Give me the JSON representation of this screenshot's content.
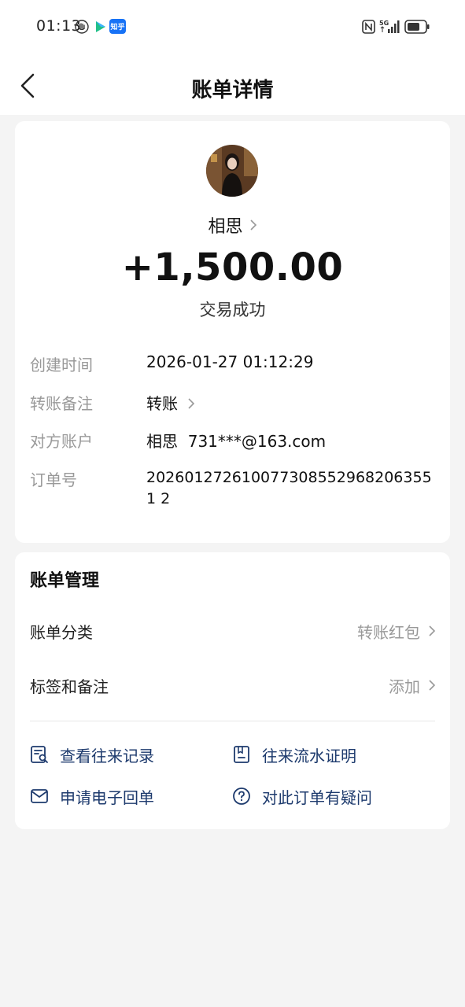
{
  "status_bar": {
    "time": "01:13",
    "icons": [
      "hand-icon",
      "play-icon",
      "zhihu-app-icon",
      "nfc-icon",
      "signal-5g-icon",
      "battery-icon"
    ],
    "zhihu_label": "知乎",
    "network": "5G"
  },
  "nav": {
    "title": "账单详情",
    "back_icon": "chevron-left-icon"
  },
  "transaction": {
    "counterparty_name": "相思",
    "amount": "+1,500.00",
    "status": "交易成功",
    "details": [
      {
        "label": "创建时间",
        "value": "2026-01-27 01:12:29"
      },
      {
        "label": "转账备注",
        "value": "转账"
      },
      {
        "label": "对方账户",
        "value": "相思  731***@163.com"
      },
      {
        "label": "订单号",
        "value": "2026012726100773085529682063551 2"
      }
    ]
  },
  "manage": {
    "title": "账单管理",
    "rows": [
      {
        "label": "账单分类",
        "value": "转账红包"
      },
      {
        "label": "标签和备注",
        "value": "添加"
      }
    ],
    "actions": [
      {
        "label": "查看往来记录",
        "icon": "record-search-icon"
      },
      {
        "label": "往来流水证明",
        "icon": "statement-doc-icon"
      },
      {
        "label": "申请电子回单",
        "icon": "mail-icon"
      },
      {
        "label": "对此订单有疑问",
        "icon": "question-circle-icon"
      }
    ]
  },
  "colors": {
    "background": "#f4f4f4",
    "card": "#ffffff",
    "label_gray": "#999999",
    "action_blue": "#1d3a6d"
  }
}
